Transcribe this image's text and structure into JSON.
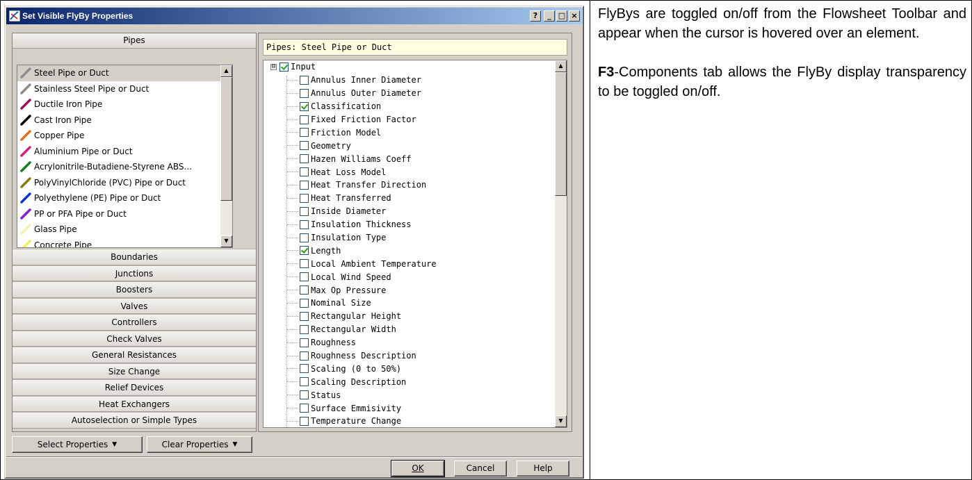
{
  "window": {
    "title": "Set Visible FlyBy Properties",
    "help_btn": "?",
    "minimize_btn": "_",
    "maximize_btn": "□",
    "close_btn": "×"
  },
  "accordion": {
    "active_header": "Pipes",
    "pipes": [
      {
        "label": "Steel Pipe or Duct",
        "color": "#8c8c8c",
        "selected": true
      },
      {
        "label": "Stainless Steel Pipe or Duct",
        "color": "#8c8c8c"
      },
      {
        "label": "Ductile Iron Pipe",
        "color": "#a0105a"
      },
      {
        "label": "Cast Iron Pipe",
        "color": "#000000"
      },
      {
        "label": "Copper Pipe",
        "color": "#e07020"
      },
      {
        "label": "Aluminium Pipe or Duct",
        "color": "#d0207a"
      },
      {
        "label": "Acrylonitrile-Butadiene-Styrene ABS...",
        "color": "#108020"
      },
      {
        "label": "PolyVinylChloride (PVC) Pipe or Duct",
        "color": "#8a7a10"
      },
      {
        "label": "Polyethylene (PE) Pipe or Duct",
        "color": "#1030d0"
      },
      {
        "label": "PP or PFA Pipe or Duct",
        "color": "#8020d0"
      },
      {
        "label": "Glass Pipe",
        "color": "#f0f0b0"
      },
      {
        "label": "Concrete Pipe",
        "color": "#f0f060"
      }
    ],
    "categories": [
      "Boundaries",
      "Junctions",
      "Boosters",
      "Valves",
      "Controllers",
      "Check Valves",
      "General Resistances",
      "Size Change",
      "Relief Devices",
      "Heat Exchangers",
      "Autoselection or Simple Types"
    ]
  },
  "properties": {
    "header": "Pipes: Steel Pipe or Duct",
    "root": {
      "label": "Input",
      "expander": "⊟",
      "checked": true
    },
    "items": [
      {
        "label": "Annulus Inner Diameter",
        "checked": false
      },
      {
        "label": "Annulus Outer Diameter",
        "checked": false
      },
      {
        "label": "Classification",
        "checked": true
      },
      {
        "label": "Fixed Friction Factor",
        "checked": false
      },
      {
        "label": "Friction Model",
        "checked": false
      },
      {
        "label": "Geometry",
        "checked": false
      },
      {
        "label": "Hazen Williams Coeff",
        "checked": false
      },
      {
        "label": "Heat Loss Model",
        "checked": false
      },
      {
        "label": "Heat Transfer Direction",
        "checked": false
      },
      {
        "label": "Heat Transferred",
        "checked": false
      },
      {
        "label": "Inside Diameter",
        "checked": false
      },
      {
        "label": "Insulation Thickness",
        "checked": false
      },
      {
        "label": "Insulation Type",
        "checked": false
      },
      {
        "label": "Length",
        "checked": true
      },
      {
        "label": "Local Ambient Temperature",
        "checked": false
      },
      {
        "label": "Local Wind Speed",
        "checked": false
      },
      {
        "label": "Max Op Pressure",
        "checked": false
      },
      {
        "label": "Nominal Size",
        "checked": false
      },
      {
        "label": "Rectangular Height",
        "checked": false
      },
      {
        "label": "Rectangular Width",
        "checked": false
      },
      {
        "label": "Roughness",
        "checked": false
      },
      {
        "label": "Roughness Description",
        "checked": false
      },
      {
        "label": "Scaling (0 to 50%)",
        "checked": false
      },
      {
        "label": "Scaling Description",
        "checked": false
      },
      {
        "label": "Status",
        "checked": false
      },
      {
        "label": "Surface Emmisivity",
        "checked": false
      },
      {
        "label": "Temperature Change",
        "checked": false
      }
    ]
  },
  "buttons": {
    "select_properties": "Select Properties",
    "clear_properties": "Clear Properties",
    "dropdown_arrow": "▼",
    "ok": "OK",
    "cancel": "Cancel",
    "help": "Help"
  },
  "description": {
    "para1": "FlyBys are toggled on/off from the Flowsheet Toolbar and appear when the cursor is hovered over an element.",
    "para2_bold": "F3",
    "para2_rest": "-Components tab allows the FlyBy display transparency to be toggled on/off."
  }
}
